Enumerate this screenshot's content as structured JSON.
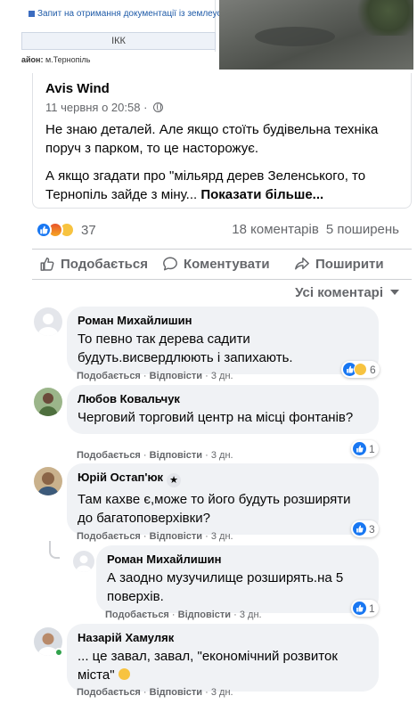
{
  "preview": {
    "doc_title": "Запит на отримання документації із землеустрою",
    "doc_button": "ІКК",
    "region_label": "айон:",
    "region_value": "м.Тернопіль"
  },
  "post": {
    "author": "Avis Wind",
    "date": "11 червня о 20:58",
    "text1": "Не знаю деталей. Але якщо стоїть будівельна техніка поруч з парком, то це насторожує.",
    "text2": "А якщо згадати про \"мільярд дерев Зеленського, то Тернопіль зайде з міну...",
    "see_more": "Показати більше..."
  },
  "reactions": {
    "count": "37",
    "comments": "18 коментарів",
    "shares": "5 поширень"
  },
  "actions": {
    "like": "Подобається",
    "comment": "Коментувати",
    "share": "Поширити"
  },
  "filter": "Усі коментарі",
  "comments": [
    {
      "name": "Роман Михайлишин",
      "text": "То певно так дерева садити будуть.висвердлюють і запихають.",
      "like": "Подобається",
      "reply": "Відповісти",
      "time": "3 дн.",
      "reactions": "6"
    },
    {
      "name": "Любов Ковальчук",
      "text": "Черговий торговий центр на місці фонтанів?",
      "like": "Подобається",
      "reply": "Відповісти",
      "time": "3 дн.",
      "reactions": "1"
    },
    {
      "name": "Юрій Остап'юк",
      "text": "Там кахве є,може то його будуть розширяти до багатоповерхівки?",
      "like": "Подобається",
      "reply": "Відповісти",
      "time": "3 дн.",
      "reactions": "3"
    },
    {
      "name": "Роман Михайлишин",
      "text": "А заодно музучилище розширять.на 5 поверхів.",
      "like": "Подобається",
      "reply": "Відповісти",
      "time": "3 дн.",
      "reactions": "1"
    },
    {
      "name": "Назарій Хамуляк",
      "text": "... це завал, завал, \"економічний розвиток міста\"",
      "like": "Подобається",
      "reply": "Відповісти",
      "time": "3 дн."
    }
  ],
  "colors": {
    "brand_blue": "#1877f2",
    "bubble_bg": "#f0f2f5",
    "secondary_text": "#65676b",
    "online_green": "#31a24c"
  }
}
